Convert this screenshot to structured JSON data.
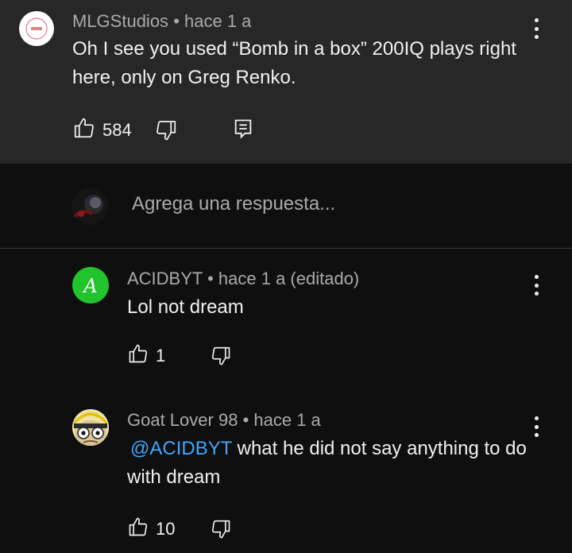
{
  "parent_comment": {
    "author": "MLGStudios",
    "time": "hace 1 a",
    "text": "Oh I see you used “Bomb in a box” 200IQ plays right here, only on Greg Renko.",
    "likes": "584"
  },
  "reply_box": {
    "placeholder": "Agrega una respuesta..."
  },
  "replies": [
    {
      "author": "ACIDBYT",
      "time": "hace 1 a (editado)",
      "text": "Lol not dream",
      "likes": "1",
      "avatar_letter": "A",
      "avatar_color": "#22c42e"
    },
    {
      "author": "Goat Lover 98",
      "time": "hace 1 a",
      "mention": "@ACIDBYT",
      "text": " what he did not say anything to do with dream",
      "likes": "10"
    }
  ],
  "separator": "•",
  "icons": [
    "thumb-up-icon",
    "thumb-down-icon",
    "reply-icon",
    "more-vert-icon"
  ]
}
